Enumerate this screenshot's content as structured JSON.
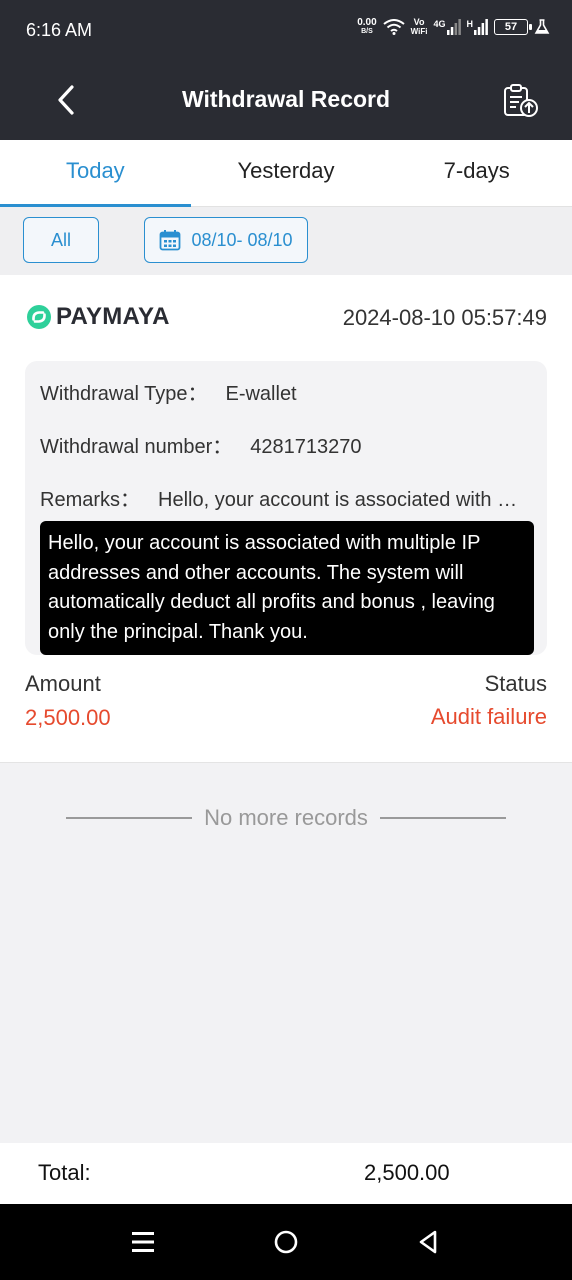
{
  "status_bar": {
    "time": "6:16 AM",
    "net_speed": "0.00",
    "net_unit": "B/S",
    "vowifi_top": "Vo",
    "vowifi_bottom": "WiFi",
    "net_4g": "4G",
    "net_h": "H",
    "battery": "57"
  },
  "header": {
    "title": "Withdrawal Record"
  },
  "tabs": [
    {
      "label": "Today",
      "active": true
    },
    {
      "label": "Yesterday",
      "active": false
    },
    {
      "label": "7-days",
      "active": false
    }
  ],
  "filters": {
    "all_label": "All",
    "date_range": "08/10- 08/10"
  },
  "record": {
    "provider": "PAYMAYA",
    "datetime": "2024-08-10 05:57:49",
    "type_label": "Withdrawal Type：",
    "type_value": "E-wallet",
    "number_label": "Withdrawal number：",
    "number_value": "4281713270",
    "remarks_label": "Remarks：",
    "remarks_value": "Hello, your account is associated with multiple IP addresses and other accounts. The system will automatically deduct all profits and bonus , leaving only the principal. Thank you.",
    "tooltip": "Hello, your account is associated with multiple IP addresses and other accounts. The system will automatically deduct all profits and bonus , leaving only the principal. Thank you.",
    "amount_label": "Amount",
    "amount_value": "2,500.00",
    "status_label": "Status",
    "status_value": "Audit failure"
  },
  "no_more": "No more records",
  "total": {
    "label": "Total:",
    "value": "2,500.00"
  },
  "colors": {
    "accent": "#2a8fd0",
    "error": "#e64a2e",
    "header": "#2a2c33",
    "brand_green": "#2ed09a"
  }
}
